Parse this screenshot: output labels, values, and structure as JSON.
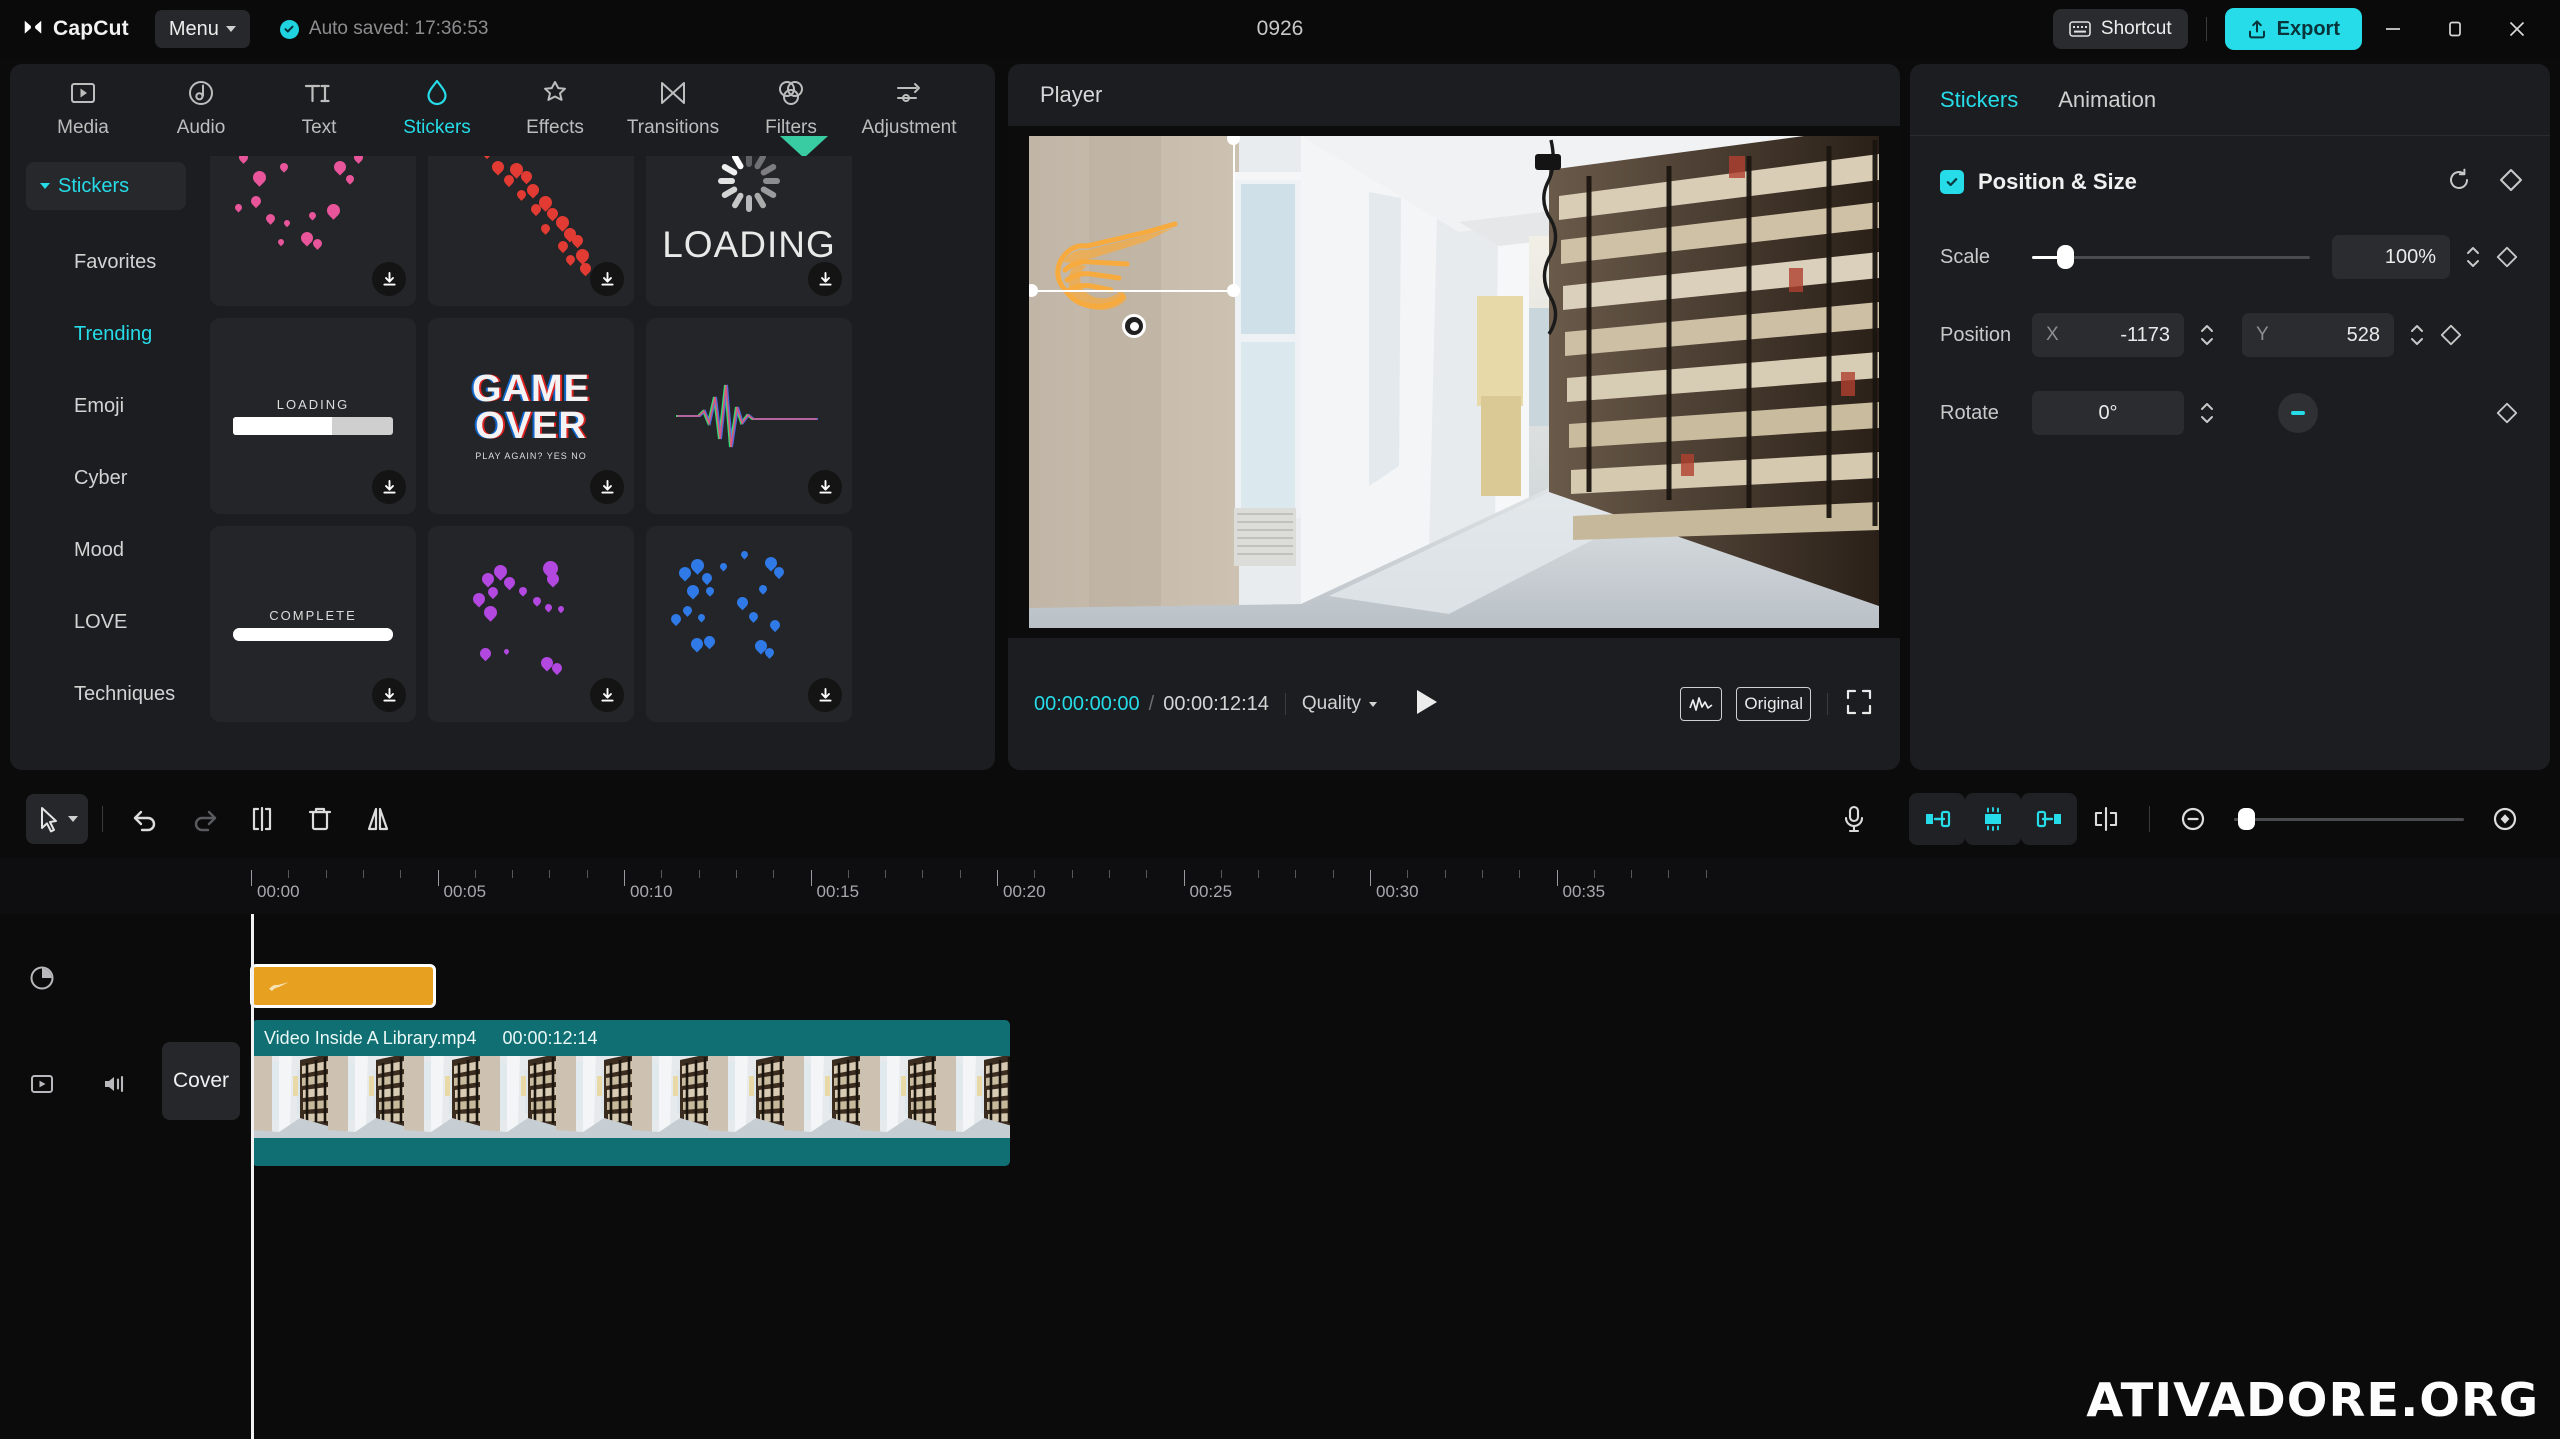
{
  "titlebar": {
    "brand": "CapCut",
    "menu_label": "Menu",
    "autosave_text": "Auto saved: 17:36:53",
    "project_title": "0926",
    "shortcut_label": "Shortcut",
    "export_label": "Export",
    "minimize_icon": "minimize-icon",
    "maximize_icon": "maximize-icon",
    "close_icon": "close-icon"
  },
  "tooltabs": [
    {
      "label": "Media",
      "icon": "media-icon",
      "active": false
    },
    {
      "label": "Audio",
      "icon": "audio-icon",
      "active": false
    },
    {
      "label": "Text",
      "icon": "text-icon",
      "active": false
    },
    {
      "label": "Stickers",
      "icon": "stickers-icon",
      "active": true
    },
    {
      "label": "Effects",
      "icon": "effects-icon",
      "active": false
    },
    {
      "label": "Transitions",
      "icon": "transitions-icon",
      "active": false
    },
    {
      "label": "Filters",
      "icon": "filters-icon",
      "active": false
    },
    {
      "label": "Adjustment",
      "icon": "adjustment-icon",
      "active": false
    }
  ],
  "categories": {
    "header": "Stickers",
    "items": [
      {
        "label": "Favorites",
        "selected": false
      },
      {
        "label": "Trending",
        "selected": true
      },
      {
        "label": "Emoji",
        "selected": false
      },
      {
        "label": "Cyber",
        "selected": false
      },
      {
        "label": "Mood",
        "selected": false
      },
      {
        "label": "LOVE",
        "selected": false
      },
      {
        "label": "Techniques",
        "selected": false
      }
    ]
  },
  "stickers": [
    {
      "kind": "hearts-pink",
      "caption": "",
      "download": true
    },
    {
      "kind": "hearts-red-trail",
      "caption": "",
      "download": true
    },
    {
      "kind": "loading-spinner",
      "caption": "LOADING",
      "download": true
    },
    {
      "kind": "loading-bar",
      "caption": "LOADING",
      "download": true
    },
    {
      "kind": "game-over",
      "caption": "GAME OVER",
      "sub": "PLAY AGAIN?   YES    NO",
      "download": true
    },
    {
      "kind": "waveform",
      "caption": "",
      "download": true
    },
    {
      "kind": "complete-bar",
      "caption": "COMPLETE",
      "download": true
    },
    {
      "kind": "hearts-purple",
      "caption": "",
      "download": true
    },
    {
      "kind": "hearts-blue",
      "caption": "",
      "download": true
    }
  ],
  "player": {
    "title": "Player",
    "current_time": "00:00:00:00",
    "total_time": "00:00:12:14",
    "separator": "/",
    "quality_label": "Quality",
    "play_icon": "play-icon",
    "waveform_icon": "audio-waveform-icon",
    "ratio_label": "Original",
    "fullscreen_icon": "fullscreen-icon"
  },
  "right_panel": {
    "tabs": [
      {
        "label": "Stickers",
        "active": true
      },
      {
        "label": "Animation",
        "active": false
      }
    ],
    "section_title": "Position & Size",
    "reset_icon": "reset-icon",
    "keyframe_icon": "keyframe-diamond-icon",
    "scale": {
      "label": "Scale",
      "value": "100%",
      "slider_pct": 12
    },
    "position": {
      "label": "Position",
      "x_axis": "X",
      "x_value": "-1173",
      "y_axis": "Y",
      "y_value": "528"
    },
    "rotate": {
      "label": "Rotate",
      "value": "0°"
    }
  },
  "timeline": {
    "tools": [
      {
        "name": "select-tool",
        "icon": "cursor-icon"
      },
      {
        "name": "undo",
        "icon": "undo-icon"
      },
      {
        "name": "redo",
        "icon": "redo-icon"
      },
      {
        "name": "split",
        "icon": "split-icon"
      },
      {
        "name": "delete",
        "icon": "trash-icon"
      },
      {
        "name": "mirror",
        "icon": "mirror-icon"
      }
    ],
    "right_tools": [
      {
        "name": "record-voiceover",
        "icon": "microphone-icon"
      },
      {
        "name": "freeze-start",
        "icon": "clip-left-icon"
      },
      {
        "name": "freeze-frame",
        "icon": "freeze-icon"
      },
      {
        "name": "clip-right",
        "icon": "clip-right-icon"
      },
      {
        "name": "split-marker",
        "icon": "split-marker-icon"
      },
      {
        "name": "zoom-out",
        "icon": "zoom-out-icon"
      },
      {
        "name": "zoom-fit",
        "icon": "fit-timeline-icon"
      }
    ],
    "ruler_labels": [
      "00:00",
      "00:05",
      "00:10",
      "00:15",
      "00:20",
      "00:25",
      "00:30",
      "00:35"
    ],
    "gutter": {
      "sticker_track_icon": "sticker-track-icon",
      "video_track_icon": "video-track-icon",
      "volume_icon": "volume-icon",
      "cover_label": "Cover"
    },
    "clips": {
      "sticker": {
        "name": "sticker-clip",
        "color": "#e8a020"
      },
      "video": {
        "name": "Video Inside A Library.mp4",
        "duration": "00:00:12:14",
        "color": "#0f6f72"
      }
    }
  },
  "watermark": "ATIVADORE.ORG",
  "colors": {
    "accent": "#25dce8",
    "panel": "#1c1d20",
    "background": "#0b0b0c",
    "sticker_clip": "#e8a020",
    "video_clip": "#0f6f72"
  }
}
